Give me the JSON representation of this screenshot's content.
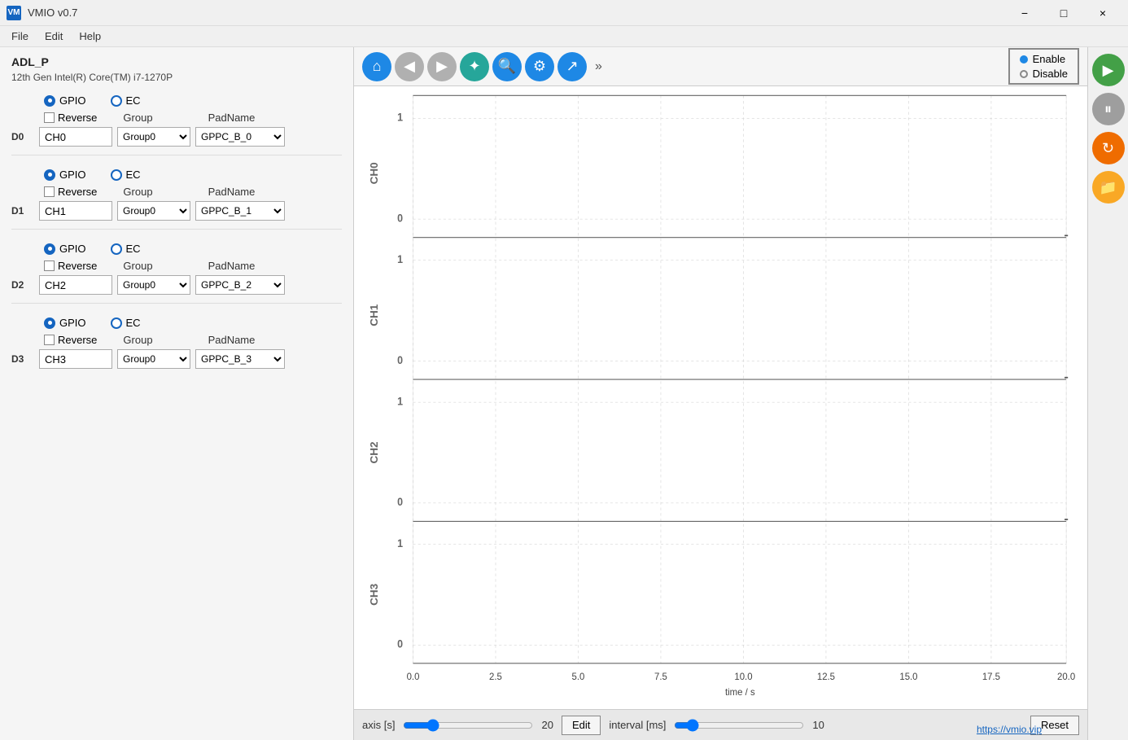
{
  "titleBar": {
    "icon": "VM",
    "title": "VMIO v0.7",
    "minimize": "−",
    "restore": "□",
    "close": "×"
  },
  "menuBar": {
    "items": [
      "File",
      "Edit",
      "Help"
    ]
  },
  "leftPanel": {
    "deviceName": "ADL_P",
    "deviceCPU": "12th Gen Intel(R) Core(TM) i7-1270P",
    "channels": [
      {
        "id": "D0",
        "name": "CH0",
        "gpio": true,
        "ec": false,
        "reverse": false,
        "group": "Group0",
        "padName": "GPPC_B_0"
      },
      {
        "id": "D1",
        "name": "CH1",
        "gpio": true,
        "ec": false,
        "reverse": false,
        "group": "Group0",
        "padName": "GPPC_B_1"
      },
      {
        "id": "D2",
        "name": "CH2",
        "gpio": true,
        "ec": false,
        "reverse": false,
        "group": "Group0",
        "padName": "GPPC_B_2"
      },
      {
        "id": "D3",
        "name": "CH3",
        "gpio": true,
        "ec": false,
        "reverse": false,
        "group": "Group0",
        "padName": "GPPC_B_3"
      }
    ],
    "labels": {
      "reverse": "Reverse",
      "group": "Group",
      "padName": "PadName",
      "gpio": "GPIO",
      "ec": "EC"
    }
  },
  "toolbar": {
    "buttons": [
      "⌂",
      "◀",
      "▶",
      "✦",
      "🔍",
      "⚙",
      "↗"
    ],
    "more": "»",
    "enableLabel": "Enable",
    "disableLabel": "Disable"
  },
  "chart": {
    "channels": [
      "CH0",
      "CH1",
      "CH2",
      "CH3"
    ],
    "xLabels": [
      "0.0",
      "2.5",
      "5.0",
      "7.5",
      "10.0",
      "12.5",
      "15.0",
      "17.5",
      "20.0"
    ],
    "xAxisLabel": "time / s",
    "yLabels": [
      "0",
      "1"
    ],
    "gridLines": 9
  },
  "bottomBar": {
    "editLabel": "Edit",
    "resetLabel": "Reset",
    "axisLabel": "axis [s]",
    "axisValue": "20",
    "intervalLabel": "interval [ms]",
    "intervalValue": "10"
  },
  "rightSidebar": {
    "startLabel": "Start",
    "pauseLabel": "Pause",
    "refreshLabel": "Refresh",
    "folderLabel": "Folder"
  },
  "footer": {
    "link": "https://vmio.vip"
  }
}
